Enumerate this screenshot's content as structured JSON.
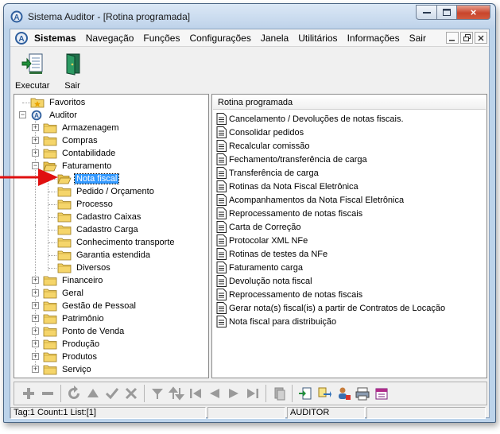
{
  "window": {
    "title": "Sistema Auditor - [Rotina programada]",
    "close_symbol": "×"
  },
  "menubar": {
    "items": [
      "Sistemas",
      "Navegação",
      "Funções",
      "Configurações",
      "Janela",
      "Utilitários",
      "Informações",
      "Sair"
    ]
  },
  "toolbar": {
    "execute_label": "Executar",
    "exit_label": "Sair"
  },
  "tree": {
    "favorites": "Favoritos",
    "root": "Auditor",
    "top_before": [
      "Armazenagem",
      "Compras",
      "Contabilidade"
    ],
    "expanded": "Faturamento",
    "children": [
      "Nota fiscal",
      "Pedido / Orçamento",
      "Processo",
      "Cadastro Caixas",
      "Cadastro Carga",
      "Conhecimento transporte",
      "Garantia estendida",
      "Diversos"
    ],
    "selected_child_index": 0,
    "top_after": [
      "Financeiro",
      "Geral",
      "Gestão de Pessoal",
      "Patrimônio",
      "Ponto de Venda",
      "Produção",
      "Produtos",
      "Serviço"
    ]
  },
  "list": {
    "header": "Rotina programada",
    "items": [
      "Cancelamento / Devoluções de notas fiscais.",
      "Consolidar pedidos",
      "Recalcular comissão",
      "Fechamento/transferência de carga",
      "Transferência de carga",
      "Rotinas da Nota Fiscal Eletrônica",
      "Acompanhamentos da Nota Fiscal Eletrônica",
      "Reprocessamento de notas fiscais",
      "Carta de Correção",
      "Protocolar XML NFe",
      "Rotinas de testes da NFe",
      "Faturamento carga",
      "Devolução nota fiscal",
      "Reprocessamento de notas fiscais",
      "Gerar nota(s) fiscal(is) a partir de Contratos de Locação",
      "Nota fiscal para distribuição"
    ]
  },
  "bottom_toolbar": {
    "icons": [
      "add-icon",
      "remove-icon",
      "refresh-icon",
      "up-icon",
      "confirm-icon",
      "cancel-icon",
      "filter-icon",
      "sort-icon",
      "first-icon",
      "prev-icon",
      "next-icon",
      "last-icon",
      "copy-icon",
      "export-icon",
      "import-icon",
      "user-icon",
      "print-icon",
      "calendar-icon"
    ]
  },
  "statusbar": {
    "info": "Tag:1 Count:1 List:[1]",
    "user": "AUDITOR"
  },
  "colors": {
    "selection": "#3399ff",
    "arrow": "#e01010",
    "folder": "#f5d56a"
  }
}
